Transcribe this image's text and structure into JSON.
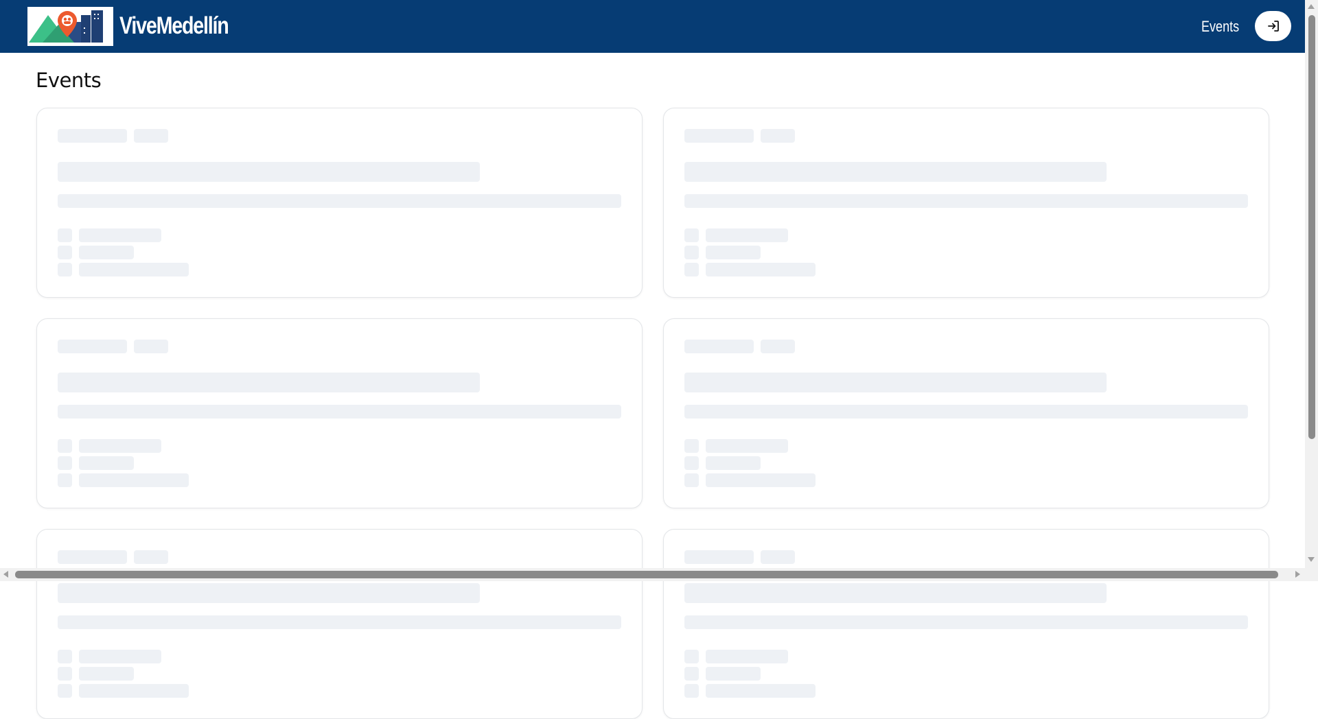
{
  "header": {
    "brand": "ViveMedellín",
    "nav_events": "Events",
    "login_icon": "login-arrow-icon",
    "logo_icon": "vivemedellin-logo",
    "background_color": "#063c74"
  },
  "main": {
    "title": "Events"
  },
  "events_list": {
    "state": "loading",
    "skeleton_color": "#eef1f5"
  }
}
